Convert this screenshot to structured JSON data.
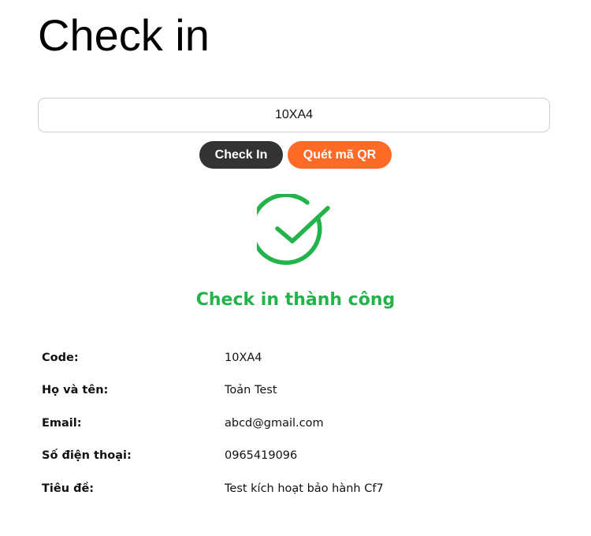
{
  "page": {
    "title": "Check in"
  },
  "form": {
    "code_value": "10XA4",
    "check_in_label": "Check In",
    "scan_qr_label": "Quét mã QR"
  },
  "result": {
    "status_icon": "check-circle-icon",
    "status_color": "#22b34a",
    "message": "Check in thành công"
  },
  "details": [
    {
      "label": "Code:",
      "value": "10XA4"
    },
    {
      "label": "Họ và tên:",
      "value": "Toản Test"
    },
    {
      "label": "Email:",
      "value": "abcd@gmail.com"
    },
    {
      "label": "Số điện thoại:",
      "value": "0965419096"
    },
    {
      "label": "Tiêu đề:",
      "value": "Test kích hoạt bảo hành Cf7"
    }
  ],
  "colors": {
    "check_in_button": "#333333",
    "scan_qr_button": "#ff6a26",
    "success": "#22b34a"
  }
}
